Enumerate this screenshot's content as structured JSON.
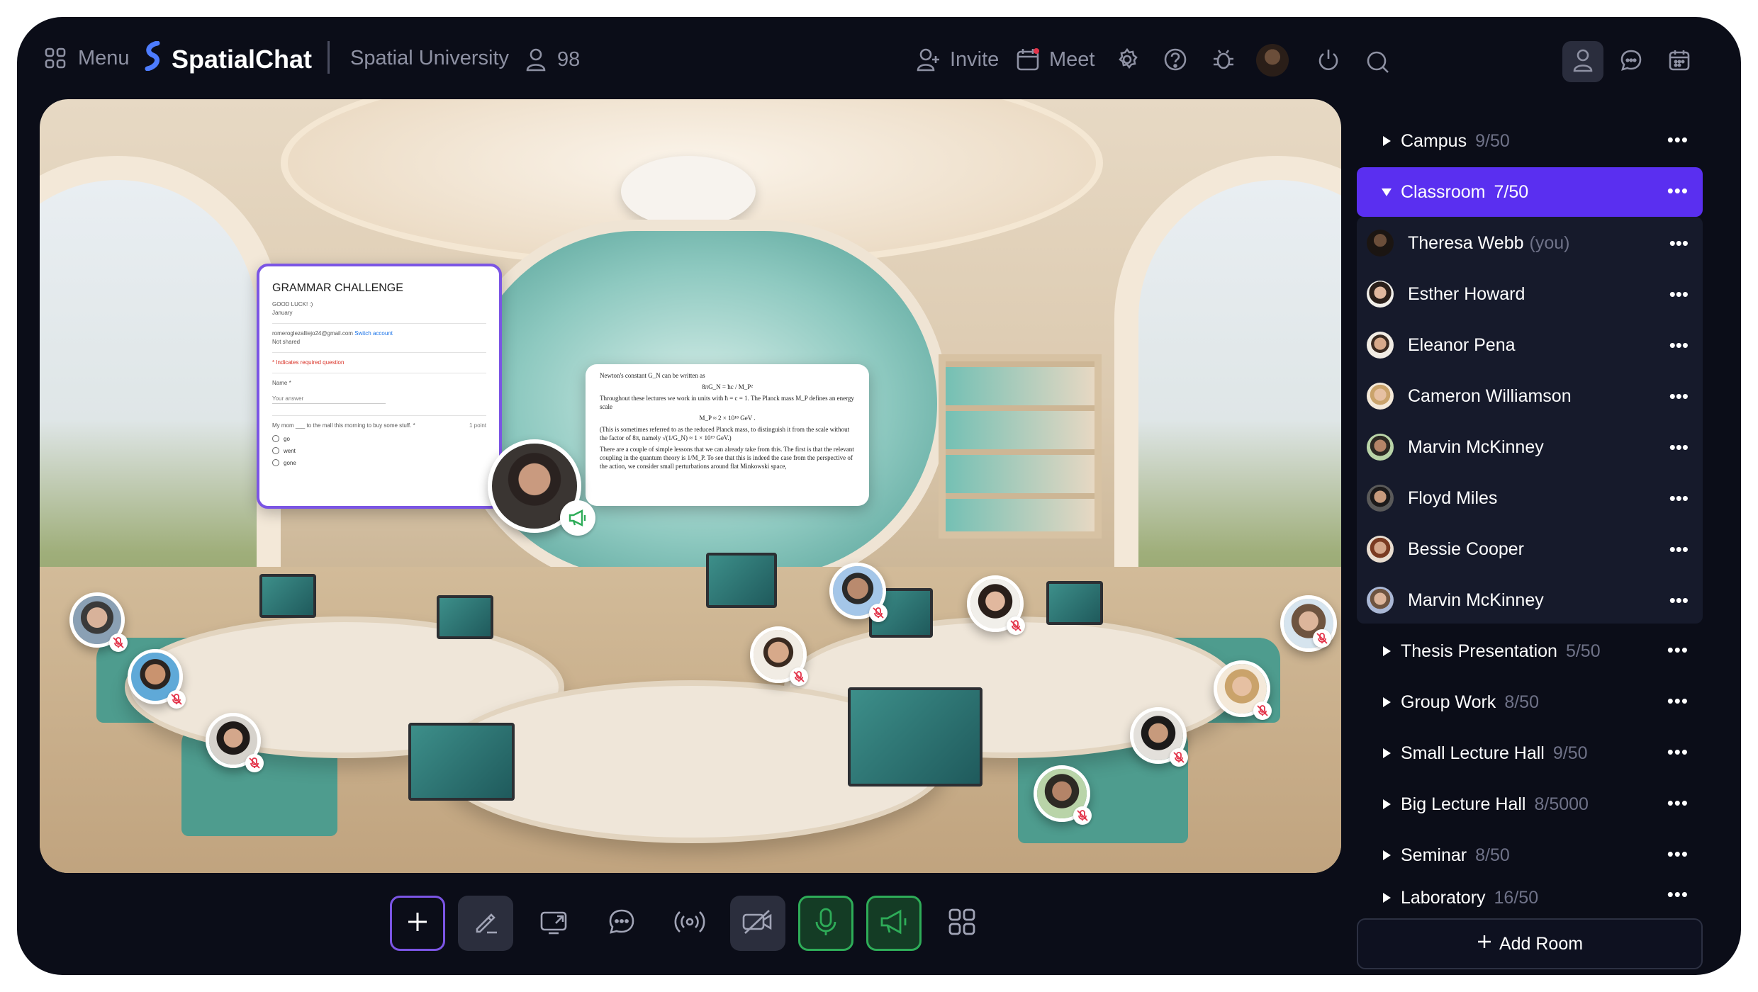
{
  "header": {
    "menu_label": "Menu",
    "brand_name": "SpatialChat",
    "space_name": "Spatial University",
    "user_count": "98",
    "invite_label": "Invite",
    "meet_label": "Meet"
  },
  "grammar_panel": {
    "title": "GRAMMAR CHALLENGE",
    "subtitle": "GOOD LUCK! :)",
    "subtitle2": "January",
    "email": "romeroglezalliejo24@gmail.com",
    "switch_label": "Switch account",
    "not_shared": "Not shared",
    "required_note": "* Indicates required question",
    "name_label": "Name *",
    "answer_placeholder": "Your answer",
    "question": "My mom ___ to the mall this morning to buy some stuff. *",
    "points": "1 point",
    "options": [
      "go",
      "went",
      "gone"
    ]
  },
  "math_panel": {
    "line1": "Newton's constant G_N can be written as",
    "formula1": "8πG_N = ħc / M_P²",
    "line2": "Throughout these lectures we work in units with ħ = c = 1. The Planck mass M_P defines an energy scale",
    "formula2": "M_P ≈ 2 × 10¹⁸ GeV .",
    "line3": "(This is sometimes referred to as the reduced Planck mass, to distinguish it from the scale without the factor of 8π, namely √(1/G_N) ≈ 1 × 10¹⁹ GeV.)",
    "line4": "There are a couple of simple lessons that we can already take from this. The first is that the relevant coupling in the quantum theory is 1/M_P. To see that this is indeed the case from the perspective of the action, we consider small perturbations around flat Minkowski space,"
  },
  "sidebar": {
    "rooms_top": [
      {
        "name": "Campus",
        "count": "9/50"
      }
    ],
    "active_room": {
      "name": "Classroom",
      "count": "7/50"
    },
    "members": [
      {
        "name": "Theresa Webb",
        "suffix": "(you)"
      },
      {
        "name": "Esther Howard",
        "suffix": ""
      },
      {
        "name": "Eleanor Pena",
        "suffix": ""
      },
      {
        "name": "Cameron Williamson",
        "suffix": ""
      },
      {
        "name": "Marvin McKinney",
        "suffix": ""
      },
      {
        "name": "Floyd Miles",
        "suffix": ""
      },
      {
        "name": "Bessie Cooper",
        "suffix": ""
      },
      {
        "name": "Marvin McKinney",
        "suffix": ""
      }
    ],
    "rooms_bottom": [
      {
        "name": "Thesis Presentation",
        "count": "5/50"
      },
      {
        "name": "Group Work",
        "count": "8/50"
      },
      {
        "name": "Small Lecture Hall",
        "count": "9/50"
      },
      {
        "name": "Big Lecture Hall",
        "count": "8/5000"
      },
      {
        "name": "Seminar",
        "count": "8/50"
      },
      {
        "name": "Laboratory",
        "count": "16/50"
      }
    ],
    "more_glyph": "•••",
    "add_room_label": "Add Room"
  },
  "colors": {
    "accent_purple": "#5a2ff0",
    "mic_green": "#2eac58",
    "background": "#0b0d18"
  }
}
